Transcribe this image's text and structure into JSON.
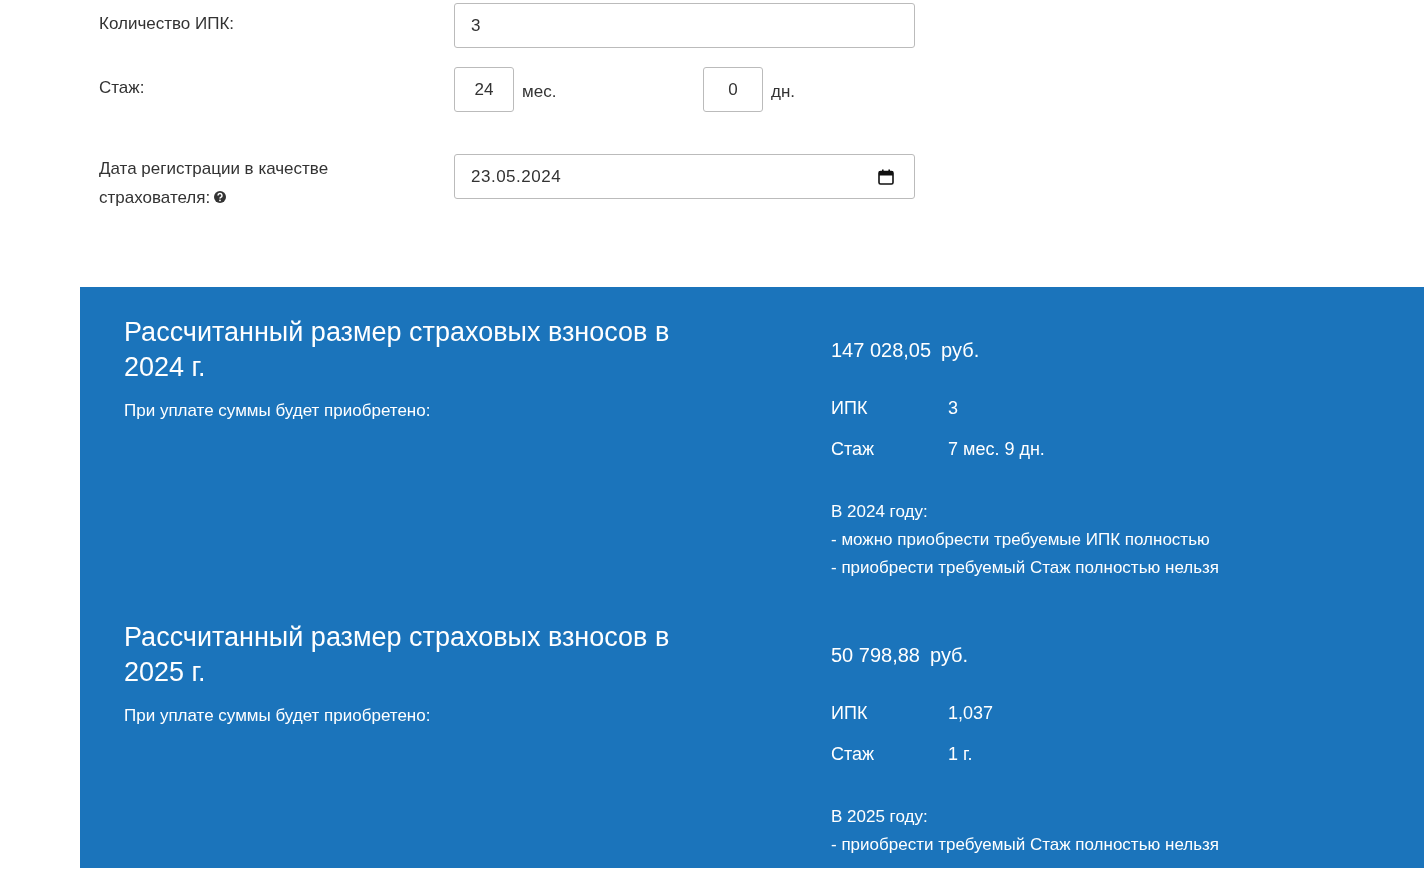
{
  "form": {
    "fields": [
      {
        "kind": "text",
        "label": "Количество ИПК:",
        "value": "3"
      },
      {
        "kind": "duration",
        "label": "Стаж:",
        "parts": [
          {
            "value": "24",
            "unit": "мес."
          },
          {
            "value": "0",
            "unit": "дн."
          }
        ]
      },
      {
        "kind": "date",
        "label": "Дата регистрации в качестве страхователя:",
        "value": "23.05.2024",
        "help": true
      }
    ]
  },
  "results": [
    {
      "title": "Рассчитанный размер страховых взносов в 2024 г.",
      "amount": "147 028,05",
      "currency": "руб.",
      "subtitle": "При уплате суммы будет приобретено:",
      "items": [
        {
          "label": "ИПК",
          "value": "3"
        },
        {
          "label": "Стаж",
          "value": "7 мес. 9 дн."
        }
      ],
      "note_title": "В 2024 году:",
      "notes": [
        "- можно приобрести требуемые ИПК полностью",
        "- приобрести требуемый Стаж полностью нельзя"
      ]
    },
    {
      "title": "Рассчитанный размер страховых взносов в 2025 г.",
      "amount": "50 798,88",
      "currency": "руб.",
      "subtitle": "При уплате суммы будет приобретено:",
      "items": [
        {
          "label": "ИПК",
          "value": "1,037"
        },
        {
          "label": "Стаж",
          "value": "1 г."
        }
      ],
      "note_title": "В 2025 году:",
      "notes": [
        "- приобрести требуемый Стаж полностью нельзя"
      ]
    }
  ]
}
